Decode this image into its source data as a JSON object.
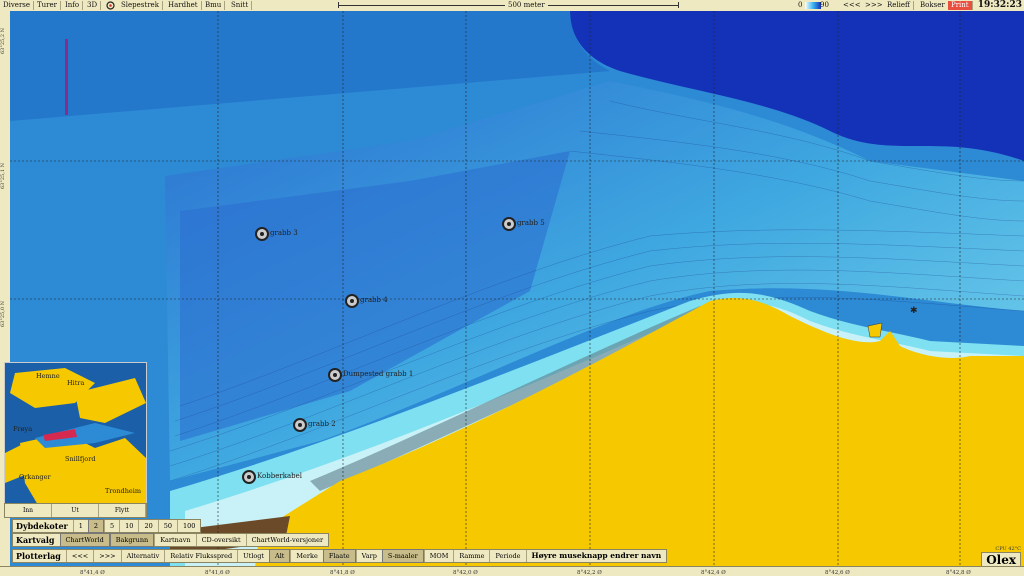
{
  "topbar": {
    "menu": [
      "Diverse",
      "Turer",
      "Info",
      "3D",
      "Slepestrek",
      "Hardhet",
      "Bmu",
      "Snitt"
    ],
    "scale": "500 meter",
    "depth_min": "0",
    "depth_max": "90",
    "nav_prev": "<<<",
    "nav_next": ">>>",
    "relief": "Relieff",
    "bokser": "Bokser",
    "print": "Print",
    "time": "19:32:23"
  },
  "lat_labels": [
    "63°25,2 N",
    "63°25,1 N",
    "63°25,0 N"
  ],
  "lon_labels": [
    "8°41,4 Ø",
    "8°41,6 Ø",
    "8°41,8 Ø",
    "8°42,0 Ø",
    "8°42,2 Ø",
    "8°42,4 Ø",
    "8°42,6 Ø",
    "8°42,8 Ø"
  ],
  "stations": [
    {
      "name": "grabb 3"
    },
    {
      "name": "grabb 5"
    },
    {
      "name": "grabb 4"
    },
    {
      "name": "Dumpested grabb 1"
    },
    {
      "name": "grabb 2"
    },
    {
      "name": "Kobberkabel"
    }
  ],
  "minimap": {
    "places": [
      "Hemne",
      "Hitra",
      "Frøya",
      "Snillfjord",
      "Orkanger",
      "Trondheim"
    ],
    "buttons": [
      "Inn",
      "Ut",
      "Flytt"
    ]
  },
  "dybdekoter": {
    "label": "Dybdekoter",
    "values": [
      "1",
      "2",
      "5",
      "10",
      "20",
      "50",
      "100"
    ],
    "selected": "2"
  },
  "kartvalg": {
    "label": "Kartvalg",
    "items": [
      "ChartWorld",
      "Bakgrunn",
      "Kartnavn",
      "CD-oversikt",
      "ChartWorld-versjoner"
    ],
    "on": [
      "ChartWorld",
      "Bakgrunn"
    ]
  },
  "plotterlag": {
    "label": "Plotterlag",
    "nav_prev": "<<<",
    "nav_next": ">>>",
    "items": [
      "Alternativ",
      "Relativ Fluksspred",
      "Utlogt",
      "Alt",
      "Merke",
      "Flaate",
      "Varp",
      "S-maaler",
      "MOM",
      "Ramme",
      "Periode"
    ],
    "on": [
      "Alt",
      "Flaate",
      "S-maaler"
    ],
    "hint": "Høyre museknapp endrer navn"
  },
  "cpu": "CPU 42°C",
  "brand": "Olex",
  "colors": {
    "deep": "#1530b8",
    "mid": "#2a7fd0",
    "shallow": "#5cc8e8",
    "land": "#f5c800",
    "panel": "#efe9c2"
  }
}
